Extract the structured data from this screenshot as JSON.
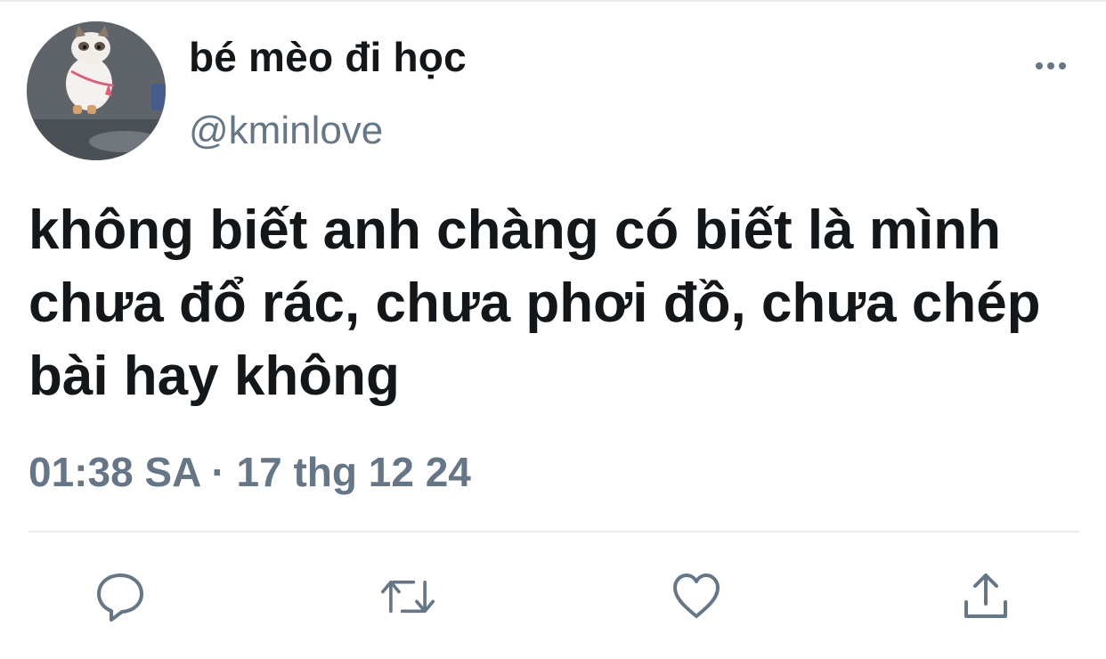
{
  "tweet": {
    "display_name": "bé mèo đi học",
    "handle": "@kminlove",
    "text": "không biết anh chàng có biết là mình chưa đổ rác, chưa phơi đồ, chưa chép bài hay không",
    "timestamp": "01:38 SA · 17 thg 12 24"
  },
  "actions": {
    "reply_icon": "speech-bubble-icon",
    "retweet_icon": "retweet-arrows-icon",
    "like_icon": "heart-icon",
    "share_icon": "share-upload-icon"
  },
  "colors": {
    "text_primary": "#14171a",
    "text_secondary": "#657786",
    "divider": "#e6ecf0"
  }
}
